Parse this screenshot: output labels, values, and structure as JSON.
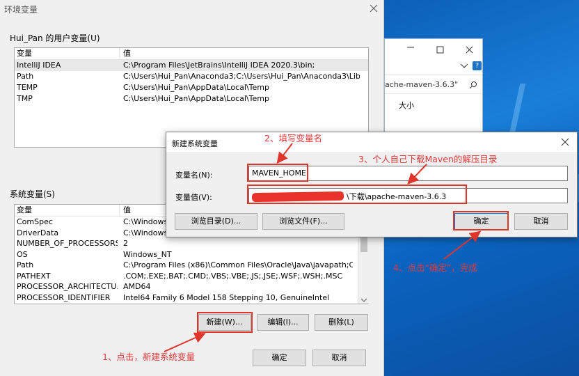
{
  "env_dialog": {
    "title": "环境变量",
    "user_group_label": "Hui_Pan 的用户变量(U)",
    "user_columns": [
      "变量",
      "值"
    ],
    "user_vars": [
      {
        "name": "IntelliJ IDEA",
        "value": "C:\\Program Files\\JetBrains\\IntelliJ IDEA 2020.3\\bin;"
      },
      {
        "name": "Path",
        "value": "C:\\Users\\Hui_Pan\\Anaconda3;C:\\Users\\Hui_Pan\\Anaconda3\\Lib..."
      },
      {
        "name": "TEMP",
        "value": "C:\\Users\\Hui_Pan\\AppData\\Local\\Temp"
      },
      {
        "name": "TMP",
        "value": "C:\\Users\\Hui_Pan\\AppData\\Local\\Temp"
      }
    ],
    "system_group_label": "系统变量(S)",
    "system_columns": [
      "变量",
      "值"
    ],
    "system_vars": [
      {
        "name": "ComSpec",
        "value": "C:\\Windows\\"
      },
      {
        "name": "DriverData",
        "value": "C:\\Windows\\"
      },
      {
        "name": "NUMBER_OF_PROCESSORS",
        "value": "2"
      },
      {
        "name": "OS",
        "value": "Windows_NT"
      },
      {
        "name": "Path",
        "value": "C:\\Program Files (x86)\\Common Files\\Oracle\\Java\\javapath;C:\\..."
      },
      {
        "name": "PATHEXT",
        "value": ".COM;.EXE;.BAT;.CMD;.VBS;.VBE;.JS;.JSE;.WSF;.WSH;.MSC"
      },
      {
        "name": "PROCESSOR_ARCHITECTU...",
        "value": "AMD64"
      },
      {
        "name": "PROCESSOR_IDENTIFIER",
        "value": "Intel64 Family 6 Model 158 Stepping 10, GenuineIntel"
      }
    ],
    "buttons": {
      "new": "新建(W)...",
      "edit": "编辑(I)...",
      "delete": "删除(L)",
      "ok": "确定",
      "cancel": "取消"
    }
  },
  "new_var_dialog": {
    "title": "新建系统变量",
    "name_label": "变量名(N):",
    "name_value": "MAVEN_HOME",
    "value_label": "变量值(V):",
    "value_value": "\\下载\\apache-maven-3.6.3",
    "browse_dir": "浏览目录(D)...",
    "browse_file": "浏览文件(F)...",
    "ok": "确定",
    "cancel": "取消"
  },
  "explorer": {
    "search_text": "ache-maven-3.6.3\"",
    "column_size": "大小"
  },
  "annotations": {
    "step1": "1、点击，新建系统变量",
    "step2": "2、填写变量名",
    "step3": "3、个人自己下载Maven的解压目录",
    "step4": "4、点击“确定”，完成"
  },
  "colors": {
    "annotation_red": "#e0352b",
    "desktop_blue": "#0b63bf",
    "dialog_bg": "#f0f0f0"
  },
  "icons": [
    "close-icon",
    "minimize-icon",
    "maximize-icon",
    "chevron-down-icon",
    "help-icon",
    "search-icon",
    "scroll-up-icon",
    "scroll-down-icon"
  ]
}
